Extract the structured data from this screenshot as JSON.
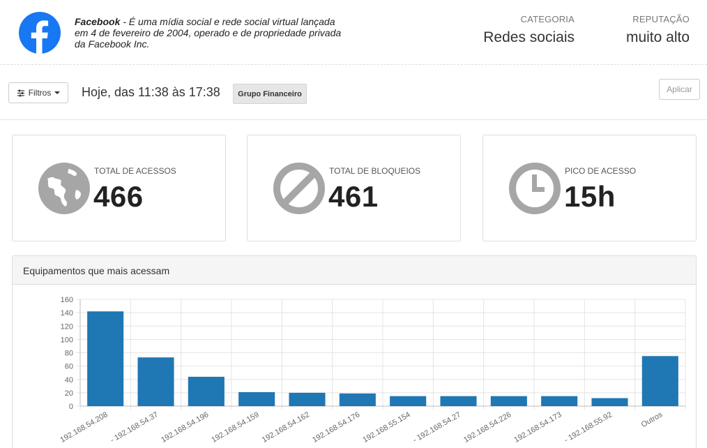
{
  "app": {
    "name": "Facebook",
    "description": " - É uma mídia social e rede social virtual lançada em 4 de fevereiro de 2004, operado e de propriedade privada da Facebook Inc.",
    "logo_icon": "facebook-logo-icon",
    "category_label": "CATEGORIA",
    "category_value": "Redes sociais",
    "reputation_label": "REPUTAÇÃO",
    "reputation_value": "muito alto"
  },
  "toolbar": {
    "filters_label": "Filtros",
    "date_range": "Hoje, das 11:38 às 17:38",
    "group_tag": "Grupo Financeiro",
    "apply_label": "Aplicar"
  },
  "stats": [
    {
      "label": "TOTAL DE ACESSOS",
      "value": "466",
      "icon": "globe-icon"
    },
    {
      "label": "TOTAL DE BLOQUEIOS",
      "value": "461",
      "icon": "block-icon"
    },
    {
      "label": "PICO DE ACESSO",
      "value": "15h",
      "icon": "clock-icon"
    }
  ],
  "colors": {
    "bar": "#1f77b4",
    "icon_gray": "#a6a6a6",
    "facebook_blue": "#1877f2"
  },
  "chart_panel": {
    "title": "Equipamentos que mais acessam"
  },
  "chart_data": {
    "type": "bar",
    "categories": [
      "192.168.54.208",
      "- 192.168.54.37",
      "192.168.54.196",
      "192.168.54.159",
      "192.168.54.162",
      "192.168.54.176",
      "192.168.55.154",
      "- 192.168.54.27",
      "192.168.54.226",
      "192.168.54.173",
      "- 192.168.55.92",
      "Outros"
    ],
    "values": [
      142,
      73,
      44,
      21,
      20,
      19,
      15,
      15,
      15,
      15,
      12,
      75
    ],
    "ylim": [
      0,
      160
    ],
    "yticks": [
      0,
      20,
      40,
      60,
      80,
      100,
      120,
      140,
      160
    ],
    "grid": true
  }
}
